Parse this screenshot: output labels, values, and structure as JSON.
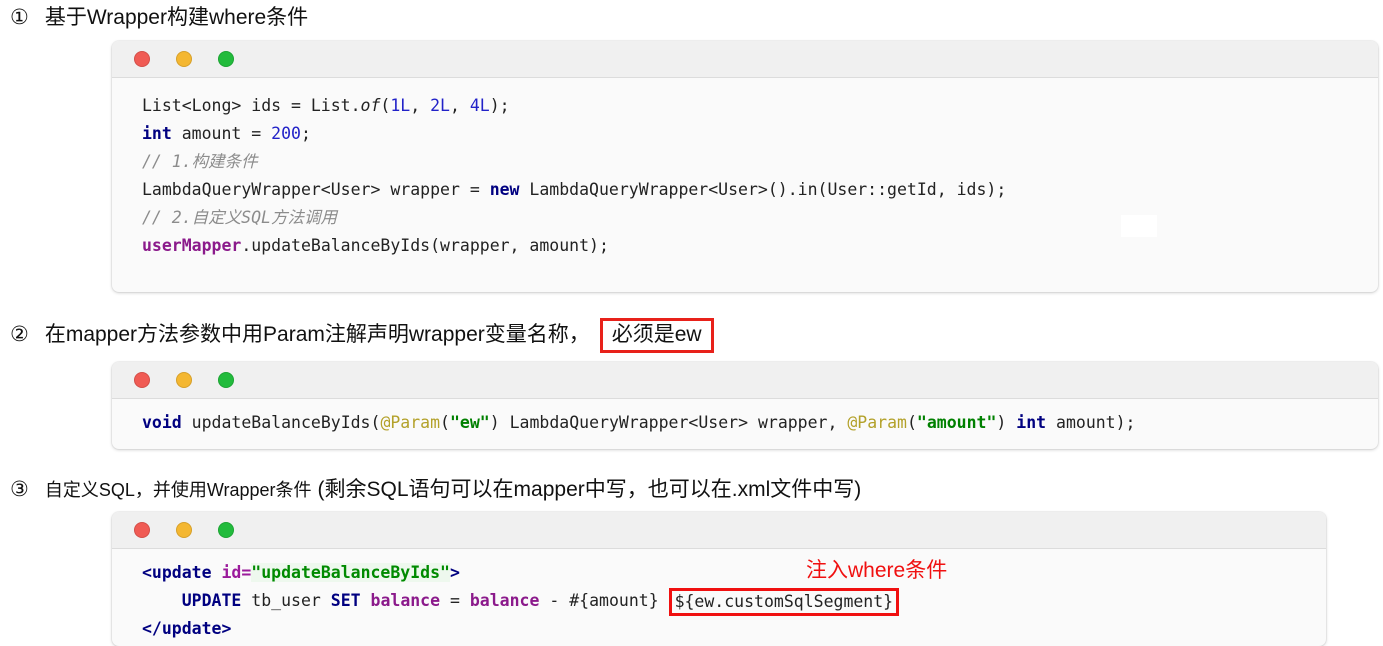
{
  "sections": [
    {
      "number": "①",
      "heading": "基于Wrapper构建where条件",
      "emphasis": null,
      "note": null
    },
    {
      "number": "②",
      "heading": "在mapper方法参数中用Param注解声明wrapper变量名称，",
      "emphasis": "必须是ew",
      "note": null
    },
    {
      "number": "③",
      "heading": "自定义SQL，并使用Wrapper条件",
      "emphasis": null,
      "note": "(剩余SQL语句可以在mapper中写，也可以在.xml文件中写)"
    }
  ],
  "window_controls": {
    "close_label": "close",
    "minimize_label": "minimize",
    "maximize_label": "maximize",
    "close_color": "#f05b54",
    "minimize_color": "#f4b731",
    "maximize_color": "#22bb3c"
  },
  "code_block_1": {
    "language": "java",
    "lines": [
      [
        {
          "t": "List<Long> ids = List.",
          "c": "plain"
        },
        {
          "t": "of",
          "c": "ital"
        },
        {
          "t": "(",
          "c": "plain"
        },
        {
          "t": "1L",
          "c": "num"
        },
        {
          "t": ", ",
          "c": "plain"
        },
        {
          "t": "2L",
          "c": "num"
        },
        {
          "t": ", ",
          "c": "plain"
        },
        {
          "t": "4L",
          "c": "num"
        },
        {
          "t": ");",
          "c": "plain"
        }
      ],
      [
        {
          "t": "int",
          "c": "kw"
        },
        {
          "t": " amount = ",
          "c": "plain"
        },
        {
          "t": "200",
          "c": "num"
        },
        {
          "t": ";",
          "c": "plain"
        }
      ],
      [
        {
          "t": "// 1.构建条件",
          "c": "cmt"
        }
      ],
      [
        {
          "t": "LambdaQueryWrapper<User> wrapper = ",
          "c": "plain"
        },
        {
          "t": "new",
          "c": "kw"
        },
        {
          "t": " LambdaQueryWrapper<User>().in(User::getId, ids);",
          "c": "plain"
        }
      ],
      [
        {
          "t": "// 2.自定义SQL方法调用",
          "c": "cmt"
        }
      ],
      [
        {
          "t": "userMapper",
          "c": "fld"
        },
        {
          "t": ".updateBalanceByIds(wrapper, amount);",
          "c": "plain"
        }
      ]
    ]
  },
  "code_block_2": {
    "language": "java",
    "lines": [
      [
        {
          "t": "void",
          "c": "kw"
        },
        {
          "t": " updateBalanceByIds(",
          "c": "plain"
        },
        {
          "t": "@Param",
          "c": "anno"
        },
        {
          "t": "(",
          "c": "plain"
        },
        {
          "t": "\"ew\"",
          "c": "str"
        },
        {
          "t": ") LambdaQueryWrapper<User> wrapper, ",
          "c": "plain"
        },
        {
          "t": "@Param",
          "c": "anno"
        },
        {
          "t": "(",
          "c": "plain"
        },
        {
          "t": "\"amount\"",
          "c": "str"
        },
        {
          "t": ") ",
          "c": "plain"
        },
        {
          "t": "int",
          "c": "kw"
        },
        {
          "t": " amount);",
          "c": "plain"
        }
      ]
    ]
  },
  "code_block_3": {
    "language": "xml",
    "annotation": "注入where条件",
    "annotation_color": "#f01010",
    "highlighted_fragment": "${ew.customSqlSegment}",
    "lines": [
      [
        {
          "t": "<update ",
          "c": "tag"
        },
        {
          "t": "id=",
          "c": "attr"
        },
        {
          "t": "\"updateBalanceByIds\"",
          "c": "xstr"
        },
        {
          "t": ">",
          "c": "tag"
        }
      ],
      [
        {
          "t": "    ",
          "c": "plain"
        },
        {
          "t": "UPDATE",
          "c": "kw"
        },
        {
          "t": " tb_user ",
          "c": "plain"
        },
        {
          "t": "SET",
          "c": "kw"
        },
        {
          "t": " ",
          "c": "plain"
        },
        {
          "t": "balance",
          "c": "fld"
        },
        {
          "t": " = ",
          "c": "plain"
        },
        {
          "t": "balance",
          "c": "fld"
        },
        {
          "t": " - #{amount} ",
          "c": "plain"
        }
      ],
      [
        {
          "t": "</update>",
          "c": "tag"
        }
      ]
    ]
  }
}
